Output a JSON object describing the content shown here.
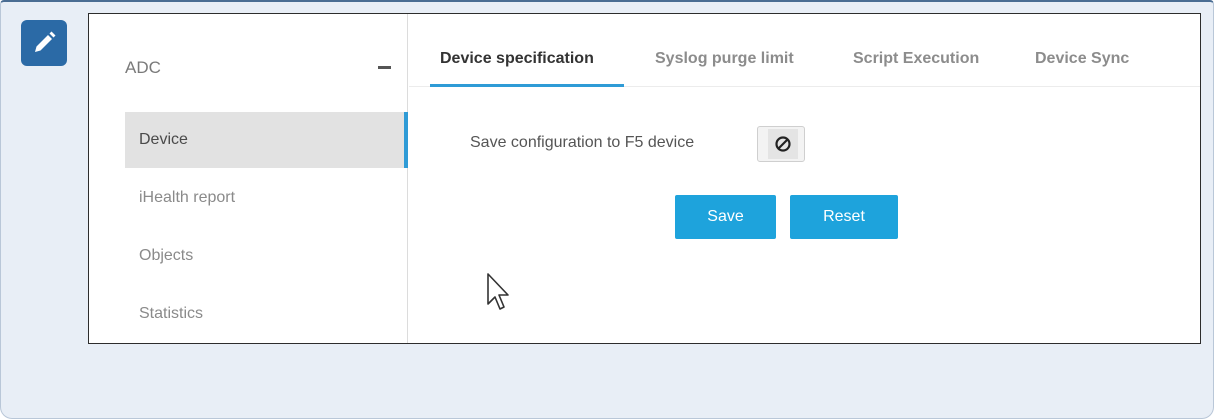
{
  "note": {
    "icon": "pencil-icon"
  },
  "sidebar": {
    "heading": "ADC",
    "collapse_icon": "minus-icon",
    "items": [
      {
        "label": "Device",
        "active": true
      },
      {
        "label": "iHealth report",
        "active": false
      },
      {
        "label": "Objects",
        "active": false
      },
      {
        "label": "Statistics",
        "active": false
      }
    ]
  },
  "tabs": [
    {
      "label": "Device specification",
      "active": true
    },
    {
      "label": "Syslog purge limit",
      "active": false
    },
    {
      "label": "Script Execution",
      "active": false
    },
    {
      "label": "Device Sync",
      "active": false
    }
  ],
  "form": {
    "save_config_label": "Save configuration to F5 device",
    "toggle_state": "off",
    "toggle_icon": "prohibited-icon",
    "save_label": "Save",
    "reset_label": "Reset"
  },
  "colors": {
    "accent": "#2f9bd6",
    "button": "#1ea3dc",
    "note_bg": "#e8eef6",
    "note_icon_bg": "#2b6aa6"
  }
}
